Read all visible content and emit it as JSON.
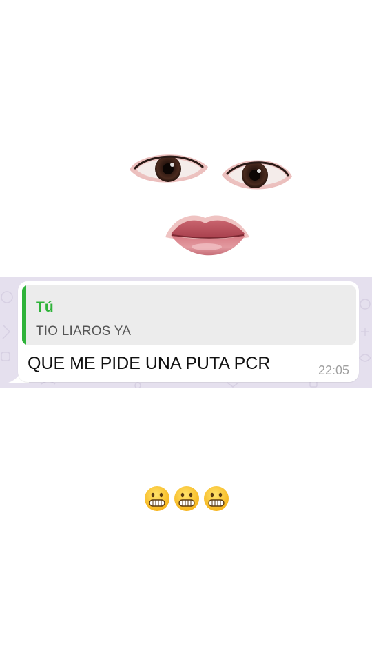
{
  "quote": {
    "author": "Tú",
    "text": "TIO LIAROS YA"
  },
  "message": {
    "text": "QUE ME PIDE UNA PUTA PCR",
    "time": "22:05"
  },
  "emojis": [
    {
      "icon": "grimacing-face-icon"
    },
    {
      "icon": "grimacing-face-icon"
    },
    {
      "icon": "grimacing-face-icon"
    }
  ],
  "colors": {
    "chat_background": "#e5e0ee",
    "bubble": "#ffffff",
    "quote_accent": "#2fb33a",
    "quote_background": "#ececec",
    "timestamp": "#a0a0a0"
  }
}
